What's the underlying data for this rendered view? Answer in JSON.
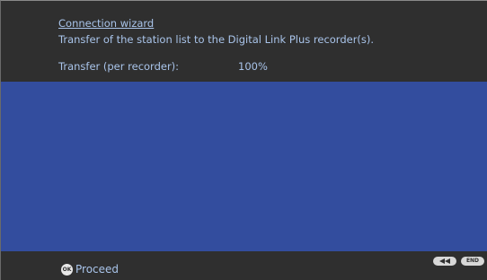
{
  "header": {
    "title": "Connection wizard",
    "subtitle": "Transfer of the station list to the Digital Link Plus recorder(s).",
    "transfer_label": "Transfer (per recorder):",
    "transfer_value": "100%"
  },
  "footer": {
    "ok_icon_text": "OK",
    "proceed_label": "Proceed",
    "back_key_icon": "rewind-icon",
    "end_key_label": "END"
  },
  "colors": {
    "background": "#2f2f2f",
    "content_area": "#334d9e",
    "text": "#a9c4ea"
  }
}
